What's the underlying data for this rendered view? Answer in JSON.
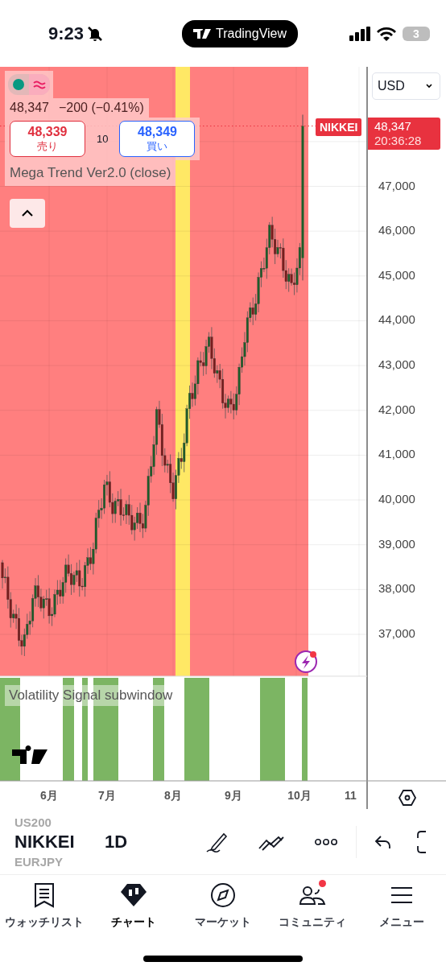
{
  "status_bar": {
    "time": "9:23",
    "app": "TradingView",
    "battery": "3"
  },
  "chart": {
    "legend": {
      "price": "48,347",
      "change": "−200 (−0.41%)"
    },
    "sell": {
      "price": "48,339",
      "label": "売り"
    },
    "spread": "10",
    "buy": {
      "price": "48,349",
      "label": "買い"
    },
    "indicator": "Mega Trend Ver2.0 (close)",
    "currency": "USD",
    "last_price": {
      "symbol": "NIKKEI",
      "price": "48,347",
      "countdown": "20:36:28"
    },
    "price_axis": [
      "47,000",
      "46,000",
      "45,000",
      "44,000",
      "43,000",
      "42,000",
      "41,000",
      "40,000",
      "39,000",
      "38,000",
      "37,000"
    ],
    "subwindow_title": "Volatility Signal subwindow",
    "time_axis": [
      "6月",
      "7月",
      "8月",
      "9月",
      "10月",
      "11"
    ]
  },
  "toolbar": {
    "symbols": [
      {
        "label": "US200",
        "selected": false
      },
      {
        "label": "NIKKEI",
        "selected": true
      },
      {
        "label": "EURJPY",
        "selected": false
      }
    ],
    "interval": "1D"
  },
  "tabs": [
    {
      "label": "ウォッチリスト",
      "selected": false,
      "badge": false
    },
    {
      "label": "チャート",
      "selected": true,
      "badge": false
    },
    {
      "label": "マーケット",
      "selected": false,
      "badge": false
    },
    {
      "label": "コミュニティ",
      "selected": false,
      "badge": true
    },
    {
      "label": "メニュー",
      "selected": false,
      "badge": false
    }
  ]
}
